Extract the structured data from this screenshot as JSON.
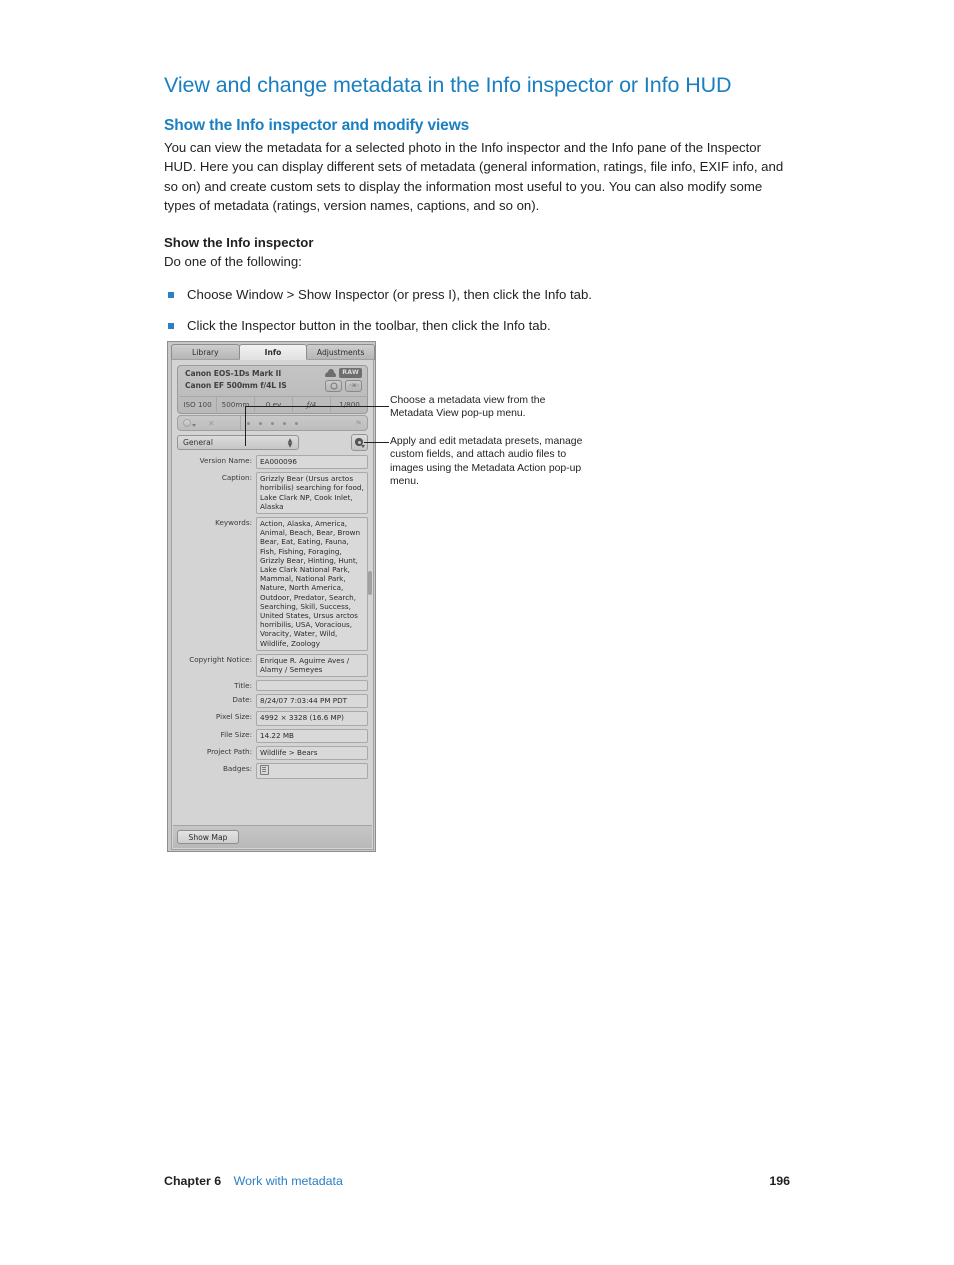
{
  "document": {
    "title": "View and change metadata in the Info inspector or Info HUD",
    "section_title": "Show the Info inspector and modify views",
    "intro_paragraph": "You can view the metadata for a selected photo in the Info inspector and the Info pane of the Inspector HUD. Here you can display different sets of metadata (general information, ratings, file info, EXIF info, and so on) and create custom sets to display the information most useful to you. You can also modify some types of metadata (ratings, version names, captions, and so on).",
    "subsection_title": "Show the Info inspector",
    "subsection_lead": "Do one of the following:",
    "bullets": [
      "Choose Window > Show Inspector (or press I), then click the Info tab.",
      "Click the Inspector button in the toolbar, then click the Info tab."
    ]
  },
  "footer": {
    "chapter": "Chapter 6",
    "chapter_title": "Work with metadata",
    "page_number": "196"
  },
  "inspector": {
    "tabs": [
      {
        "label": "Library",
        "active": false
      },
      {
        "label": "Info",
        "active": true
      },
      {
        "label": "Adjustments",
        "active": false
      }
    ],
    "camera": {
      "body": "Canon EOS-1Ds Mark II",
      "lens": "Canon EF 500mm f/4L IS",
      "raw_badge": "RAW",
      "cloud_icon": "cloud-icon",
      "exif": [
        {
          "label": "ISO 100",
          "italic": false
        },
        {
          "label": "500mm",
          "italic": false
        },
        {
          "label": "0 ev",
          "italic": false
        },
        {
          "label": "ƒ/4",
          "italic": true
        },
        {
          "label": "1/800",
          "italic": false
        }
      ]
    },
    "rating_row": {
      "color_label_icon": "color-label-popup-icon",
      "reject_icon": "reject-x-icon",
      "star_count": 5,
      "flag_icon": "flag-icon"
    },
    "metadata_view_popup": {
      "selected": "General",
      "name": "metadata-view-popup"
    },
    "action_button": {
      "name": "metadata-action-button",
      "icon": "gear-icon"
    },
    "fields": [
      {
        "label": "Version Name:",
        "value": "EA000096",
        "multiline": false
      },
      {
        "label": "Caption:",
        "value": "Grizzly Bear (Ursus arctos horribilis) searching for food, Lake Clark NP, Cook Inlet, Alaska",
        "multiline": true
      },
      {
        "label": "Keywords:",
        "value": "Action, Alaska, America, Animal, Beach, Bear, Brown Bear, Eat, Eating, Fauna, Fish, Fishing, Foraging, Grizzly Bear, Hinting, Hunt, Lake Clark National Park, Mammal, National Park, Nature, North America, Outdoor, Predator, Search, Searching, Skill, Success, United States, Ursus arctos horribilis, USA, Voracious, Voracity, Water, Wild, Wildlife, Zoology",
        "multiline": true
      },
      {
        "label": "Copyright Notice:",
        "value": "Enrique R. Aguirre Aves / Alamy / Semeyes",
        "multiline": true
      },
      {
        "label": "Title:",
        "value": "",
        "multiline": false
      },
      {
        "label": "Date:",
        "value": "8/24/07 7:03:44 PM PDT",
        "multiline": false
      },
      {
        "label": "Pixel Size:",
        "value": "4992 × 3328 (16.6 MP)",
        "multiline": false
      },
      {
        "label": "File Size:",
        "value": "14.22 MB",
        "multiline": false
      },
      {
        "label": "Project Path:",
        "value": "Wildlife > Bears",
        "multiline": false
      },
      {
        "label": "Badges:",
        "value": "",
        "multiline": false,
        "icon": "badge-icon"
      }
    ],
    "show_map_button": "Show Map"
  },
  "callouts": {
    "metadata_view": "Choose a metadata view from the Metadata View pop-up menu.",
    "metadata_action": "Apply and edit metadata presets, manage custom fields, and attach audio files to images using the Metadata Action pop-up menu."
  },
  "colors": {
    "heading_blue": "#1a7fc1",
    "link_blue": "#2b7fc4",
    "bullet_blue": "#2b7fc4",
    "body_text": "#231f20"
  }
}
